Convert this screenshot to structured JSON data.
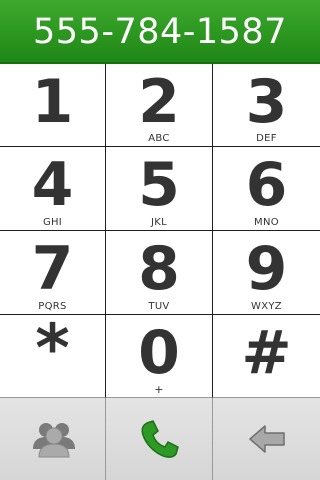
{
  "display": {
    "number": "555-784-1587",
    "background_color": "#2f9a22"
  },
  "keypad": {
    "keys": [
      {
        "digit": "1",
        "letters": ""
      },
      {
        "digit": "2",
        "letters": "ABC"
      },
      {
        "digit": "3",
        "letters": "DEF"
      },
      {
        "digit": "4",
        "letters": "GHI"
      },
      {
        "digit": "5",
        "letters": "JKL"
      },
      {
        "digit": "6",
        "letters": "MNO"
      },
      {
        "digit": "7",
        "letters": "PQRS"
      },
      {
        "digit": "8",
        "letters": "TUV"
      },
      {
        "digit": "9",
        "letters": "WXYZ"
      },
      {
        "digit": "*",
        "letters": ""
      },
      {
        "digit": "0",
        "letters": "+"
      },
      {
        "digit": "#",
        "letters": ""
      }
    ]
  },
  "actions": {
    "contacts_icon": "contacts-icon",
    "call_icon": "phone-icon",
    "call_color": "#2e9a26",
    "backspace_icon": "backspace-arrow-icon"
  }
}
